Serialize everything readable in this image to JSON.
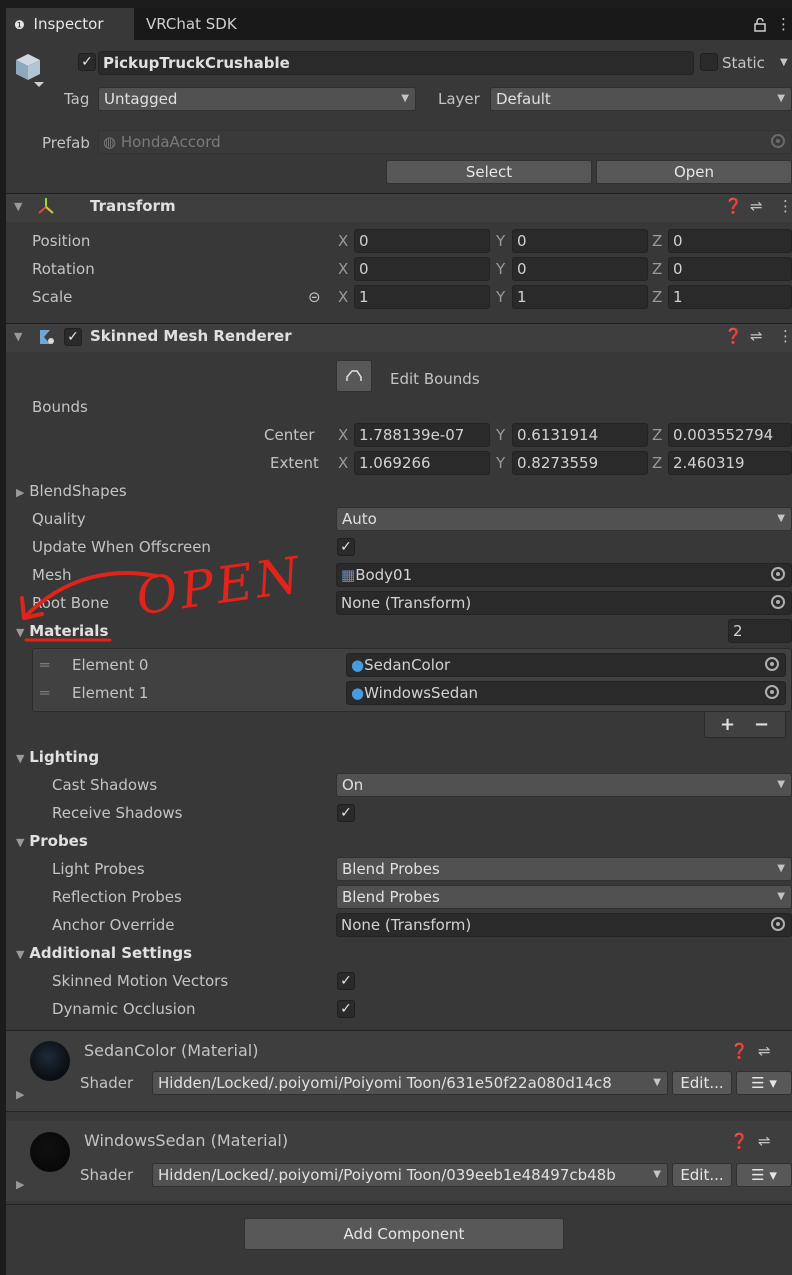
{
  "tabs": {
    "inspector": "Inspector",
    "vrchat_sdk": "VRChat SDK"
  },
  "object": {
    "name": "PickupTruckCrushable",
    "static_label": "Static",
    "tag_label": "Tag",
    "tag_value": "Untagged",
    "layer_label": "Layer",
    "layer_value": "Default"
  },
  "prefab": {
    "label": "Prefab",
    "value": "HondaAccord",
    "select_label": "Select",
    "open_label": "Open"
  },
  "transform": {
    "title": "Transform",
    "position_label": "Position",
    "rotation_label": "Rotation",
    "scale_label": "Scale",
    "axis_x": "X",
    "axis_y": "Y",
    "axis_z": "Z",
    "position": {
      "x": "0",
      "y": "0",
      "z": "0"
    },
    "rotation": {
      "x": "0",
      "y": "0",
      "z": "0"
    },
    "scale": {
      "x": "1",
      "y": "1",
      "z": "1"
    }
  },
  "smr": {
    "title": "Skinned Mesh Renderer",
    "edit_bounds": "Edit Bounds",
    "bounds_label": "Bounds",
    "center_label": "Center",
    "extent_label": "Extent",
    "center": {
      "x": "1.788139e-07",
      "y": "0.6131914",
      "z": "0.003552794"
    },
    "extent": {
      "x": "1.069266",
      "y": "0.8273559",
      "z": "2.460319"
    },
    "blendshapes_label": "BlendShapes",
    "quality_label": "Quality",
    "quality_value": "Auto",
    "update_offscreen_label": "Update When Offscreen",
    "mesh_label": "Mesh",
    "mesh_value": "Body01",
    "root_bone_label": "Root Bone",
    "root_bone_value": "None (Transform)",
    "materials_label": "Materials",
    "materials_count": "2",
    "materials": [
      {
        "element": "Element 0",
        "value": "SedanColor"
      },
      {
        "element": "Element 1",
        "value": "WindowsSedan"
      }
    ],
    "add_symbol": "+",
    "remove_symbol": "−",
    "lighting_label": "Lighting",
    "cast_shadows_label": "Cast Shadows",
    "cast_shadows_value": "On",
    "receive_shadows_label": "Receive Shadows",
    "probes_label": "Probes",
    "light_probes_label": "Light Probes",
    "light_probes_value": "Blend Probes",
    "reflection_probes_label": "Reflection Probes",
    "reflection_probes_value": "Blend Probes",
    "anchor_override_label": "Anchor Override",
    "anchor_override_value": "None (Transform)",
    "additional_label": "Additional Settings",
    "skinned_motion_label": "Skinned Motion Vectors",
    "dynamic_occlusion_label": "Dynamic Occlusion"
  },
  "annotation": {
    "text": "OPEN",
    "color": "#e0241b"
  },
  "material_blocks": [
    {
      "title": "SedanColor (Material)",
      "shader_label": "Shader",
      "shader_value": "Hidden/Locked/.poiyomi/Poiyomi Toon/631e50f22a080d14c8",
      "edit_label": "Edit..."
    },
    {
      "title": "WindowsSedan (Material)",
      "shader_label": "Shader",
      "shader_value": "Hidden/Locked/.poiyomi/Poiyomi Toon/039eeb1e48497cb48b",
      "edit_label": "Edit..."
    }
  ],
  "add_component": "Add Component",
  "colors": {
    "panel": "#383838",
    "field": "#2a2a2a",
    "header": "#3e3e3e",
    "accent": "#4a9bdc"
  }
}
